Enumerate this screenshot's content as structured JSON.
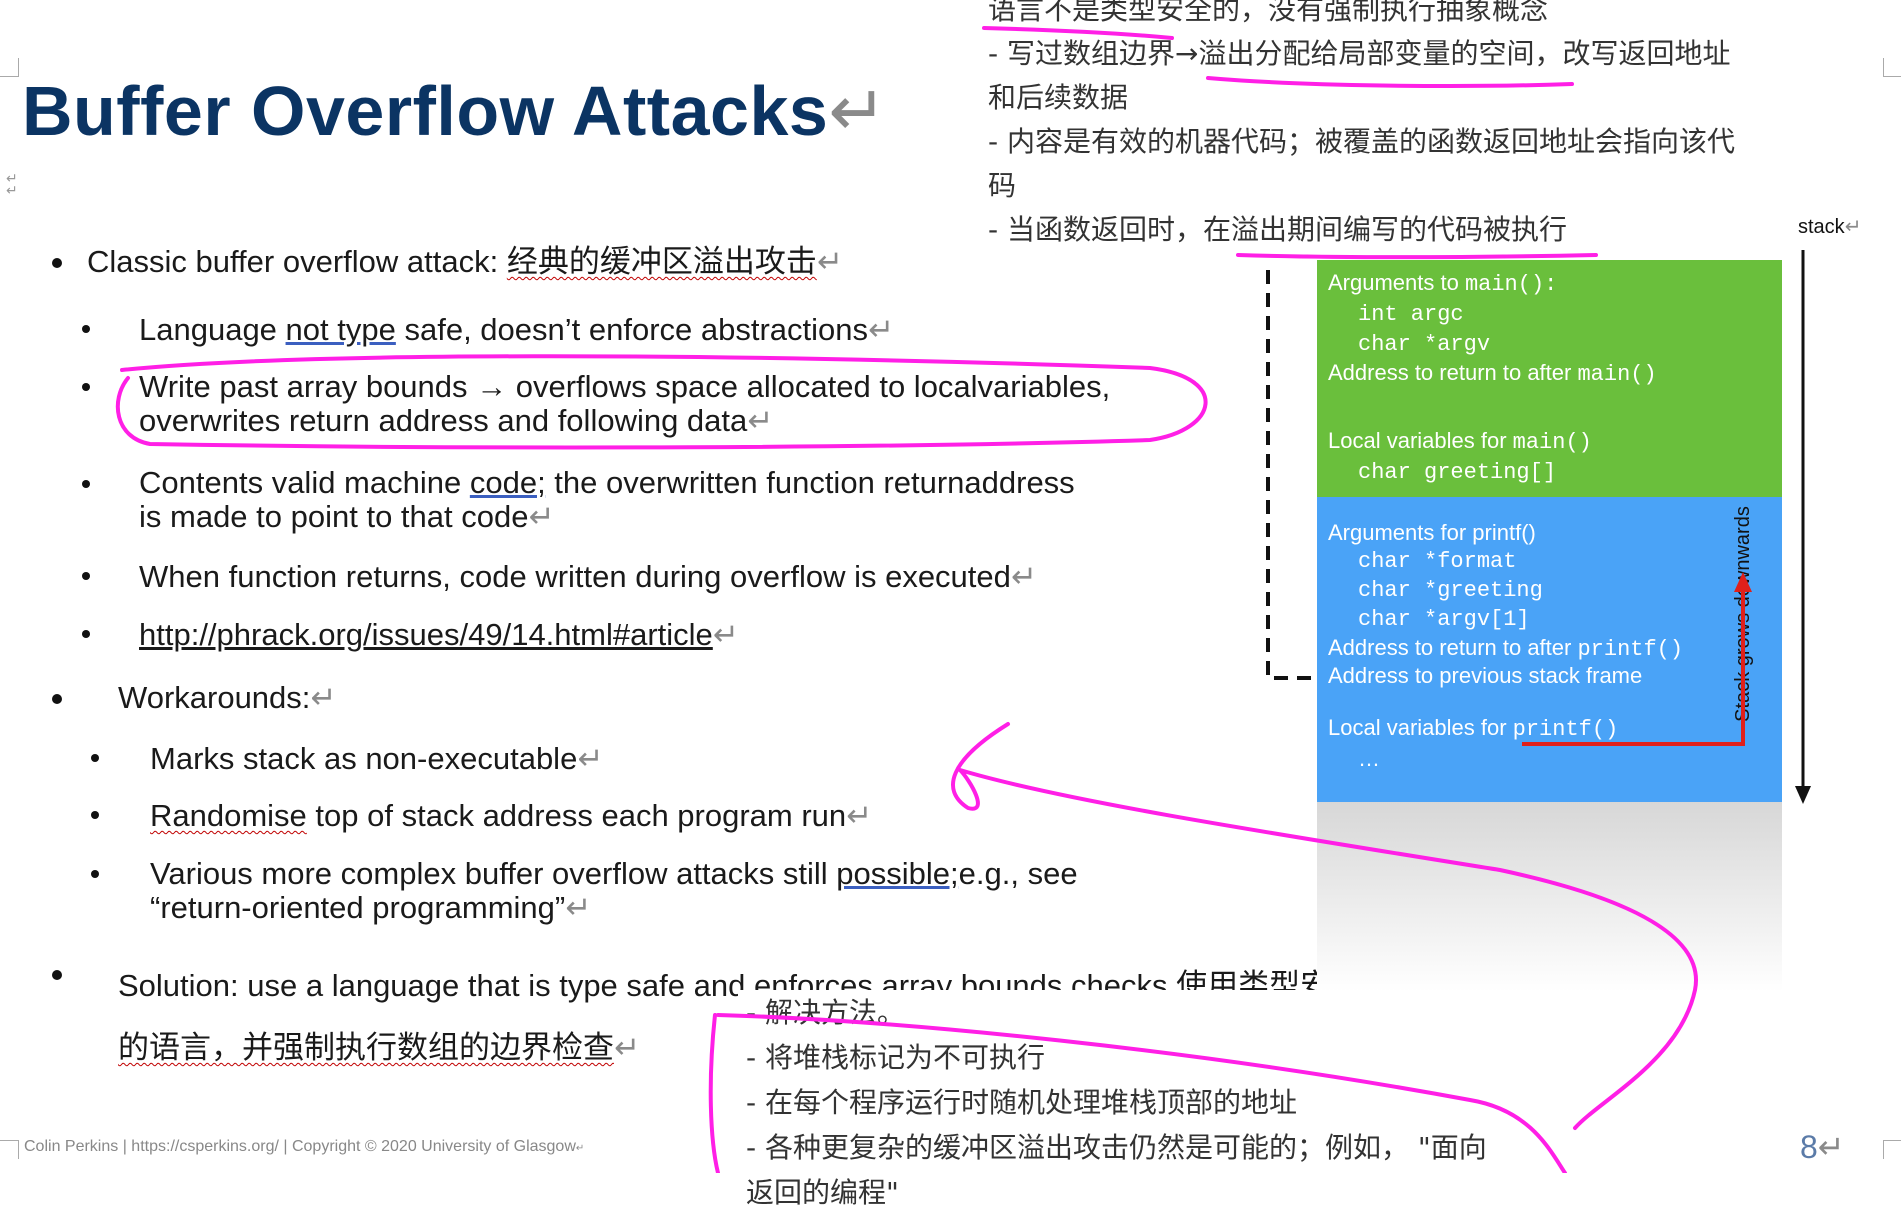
{
  "title": "Buffer Overflow Attacks",
  "para_mark": "↵",
  "cn_top": {
    "line1": "语言不是类型安全的，没有强制执行抽象概念",
    "line2": "- 写过数组边界→溢出分配给局部变量的空间，改写返回地址",
    "line3": "和后续数据",
    "line4": "- 内容是有效的机器代码；被覆盖的函数返回地址会指向该代",
    "line5": "码",
    "line6": "- 当函数返回时，在溢出期间编写的代码被执行"
  },
  "bullets": {
    "classic_prefix": "Classic buffer overflow attack: ",
    "classic_cn": "经典的缓冲区溢出攻击",
    "sub1_a": "Language ",
    "sub1_b": "not type",
    "sub1_c": " safe, doesn’t enforce abstractions",
    "sub2_line1": "Write past array bounds → overflows space allocated to localvariables,",
    "sub2_line2": "overwrites return address and following data",
    "sub3_a": "Contents valid machine ",
    "sub3_b": "code;",
    "sub3_c": " the overwritten function returnaddress",
    "sub3_line2": "is made to point to that code",
    "sub4": "When function returns, code written during overflow is executed",
    "sub5_link": "http://phrack.org/issues/49/14.html#article",
    "workarounds": "Workarounds:",
    "w1": "Marks stack as non-executable",
    "w2_a": "Randomise",
    "w2_b": " top of stack address each program run",
    "w3_a": "Various more complex buffer overflow attacks still ",
    "w3_b": "possible;",
    "w3_c": "e.g., see",
    "w3_line2": "“return-oriented programming”",
    "solution_line1": "Solution: use a language that is type safe and enforces array bounds checks 使用类型安全",
    "solution_line2": "的语言，并强制执行数组的边界检查"
  },
  "cn_bottom": {
    "line1": "- 解决方法。",
    "line2": "- 将堆栈标记为不可执行",
    "line3": "- 在每个程序运行时随机处理堆栈顶部的地址",
    "line4": "- 各种更复杂的缓冲区溢出攻击仍然是可能的；例如，  \"面向",
    "line5": "返回的编程\""
  },
  "stack": {
    "top_label": "stack",
    "side_label": "Stack grows downwards",
    "green": {
      "args_main_a": "Arguments to ",
      "args_main_b": "main():",
      "argc": "int argc",
      "argv": "char *argv",
      "ret_main_a": "Address to return to after ",
      "ret_main_b": "main()",
      "locals_main_a": "Local variables for ",
      "locals_main_b": "main()",
      "greeting": "char greeting[]"
    },
    "blue": {
      "args_printf": "Arguments for printf()",
      "format": "char *format",
      "greeting_ptr": "char *greeting",
      "argv1": "char *argv[1]",
      "ret_printf_a": "Address to return to after ",
      "ret_printf_b": "printf()",
      "prev_frame": "Address to previous stack frame",
      "locals_printf_a": "Local variables for ",
      "locals_printf_b": "printf()",
      "ellipsis": "…"
    },
    "colors": {
      "green": "#6abf3c",
      "blue": "#4aa3f7",
      "arrow_red": "#e0201b"
    }
  },
  "footer": "Colin Perkins | https://csperkins.org/ | Copyright © 2020 University of Glasgow",
  "page_number": "8",
  "annotation_color": "#ff1fe6"
}
